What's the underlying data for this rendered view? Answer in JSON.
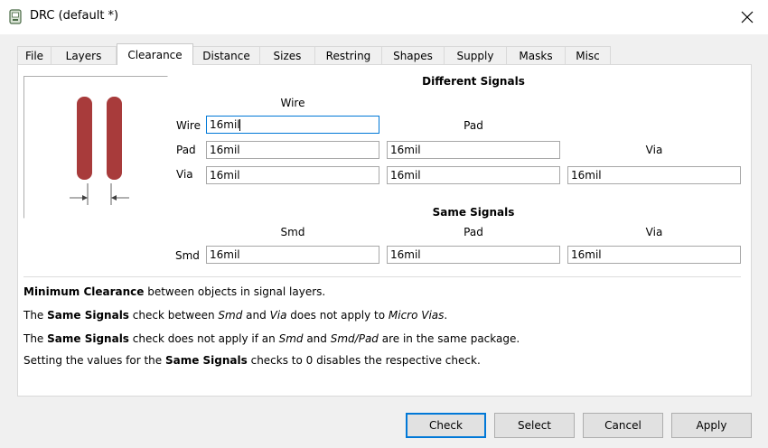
{
  "window": {
    "title": "DRC (default *)"
  },
  "tabs": [
    {
      "label": "File",
      "active": false
    },
    {
      "label": "Layers",
      "active": false
    },
    {
      "label": "Clearance",
      "active": true
    },
    {
      "label": "Distance",
      "active": false
    },
    {
      "label": "Sizes",
      "active": false
    },
    {
      "label": "Restring",
      "active": false
    },
    {
      "label": "Shapes",
      "active": false
    },
    {
      "label": "Supply",
      "active": false
    },
    {
      "label": "Masks",
      "active": false
    },
    {
      "label": "Misc",
      "active": false
    }
  ],
  "different_signals": {
    "heading": "Different Signals",
    "columns": [
      "Wire",
      "Pad",
      "Via"
    ],
    "rows": {
      "wire": {
        "label": "Wire",
        "values": [
          "16mil"
        ]
      },
      "pad": {
        "label": "Pad",
        "values": [
          "16mil",
          "16mil"
        ]
      },
      "via": {
        "label": "Via",
        "values": [
          "16mil",
          "16mil",
          "16mil"
        ]
      }
    }
  },
  "same_signals": {
    "heading": "Same Signals",
    "columns": [
      "Smd",
      "Pad",
      "Via"
    ],
    "row": {
      "label": "Smd",
      "values": [
        "16mil",
        "16mil",
        "16mil"
      ]
    }
  },
  "notes": {
    "line1": {
      "b1": "Minimum Clearance",
      "t1": " between objects in signal layers."
    },
    "line2": {
      "t1": "The ",
      "b1": "Same Signals",
      "t2": " check between ",
      "i1": "Smd",
      "t3": " and ",
      "i2": "Via",
      "t4": " does not apply to ",
      "i3": "Micro Vias",
      "t5": "."
    },
    "line3": {
      "t1": "The ",
      "b1": "Same Signals",
      "t2": " check does not apply if an ",
      "i1": "Smd",
      "t3": " and ",
      "i2": "Smd/Pad",
      "t4": " are in the same package."
    },
    "line4": {
      "t1": "Setting the values for the ",
      "b1": "Same Signals",
      "t2": " checks to 0 disables the respective check."
    }
  },
  "buttons": {
    "check": "Check",
    "select": "Select",
    "cancel": "Cancel",
    "apply": "Apply"
  },
  "colors": {
    "accent": "#0078d7",
    "wire_fill": "#a83b3b"
  }
}
